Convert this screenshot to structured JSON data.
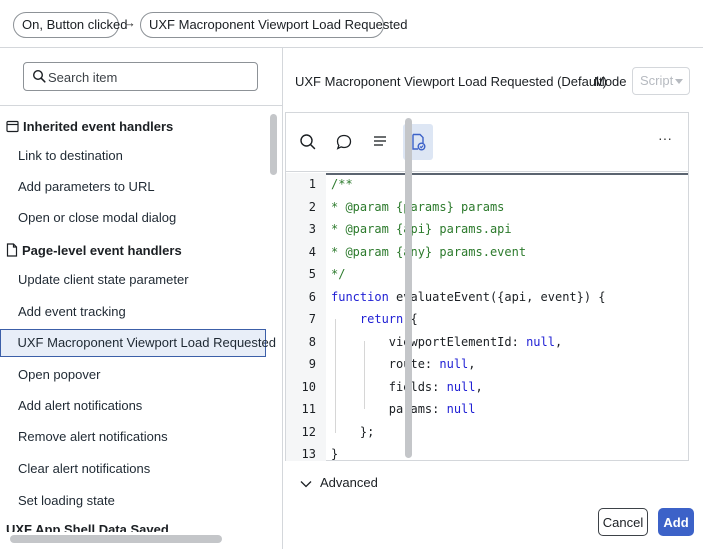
{
  "breadcrumb": {
    "items": [
      "On, Button clicked",
      "UXF Macroponent Viewport Load Requested"
    ],
    "separator": "→"
  },
  "search": {
    "placeholder": "Search item"
  },
  "sections": {
    "inherited": {
      "title": "Inherited event handlers",
      "items": [
        "Link to destination",
        "Add parameters to URL",
        "Open or close modal dialog"
      ]
    },
    "page_level": {
      "title": "Page-level event handlers",
      "items": [
        "Update client state parameter",
        "Add event tracking",
        "UXF Macroponent Viewport Load Requested",
        "Open popover",
        "Add alert notifications",
        "Remove alert notifications",
        "Clear alert notifications",
        "Set loading state"
      ],
      "selected": "UXF Macroponent Viewport Load Requested",
      "partial_next": "UXF App Shell Data Saved"
    }
  },
  "editor": {
    "title": "UXF Macroponent Viewport Load Requested (Default)",
    "mode_label": "Mode",
    "mode_value": "Script",
    "more_label": "···",
    "code": [
      {
        "n": "1",
        "t": "/**"
      },
      {
        "n": "2",
        "t": "* @param {params} params"
      },
      {
        "n": "3",
        "t": "* @param {api} params.api"
      },
      {
        "n": "4",
        "t": "* @param {any} params.event"
      },
      {
        "n": "5",
        "t": "*/"
      },
      {
        "n": "6",
        "t": "function evaluateEvent({api, event}) {"
      },
      {
        "n": "7",
        "t": "    return {"
      },
      {
        "n": "8",
        "t": "        viewportElementId: null,"
      },
      {
        "n": "9",
        "t": "        route: null,"
      },
      {
        "n": "10",
        "t": "        fields: null,"
      },
      {
        "n": "11",
        "t": "        params: null"
      },
      {
        "n": "12",
        "t": "    };"
      },
      {
        "n": "13",
        "t": "}"
      }
    ]
  },
  "advanced": {
    "label": "Advanced"
  },
  "buttons": {
    "cancel": "Cancel",
    "add": "Add"
  },
  "colors": {
    "accent": "#3c62c8",
    "selected_bg": "#e8eef8",
    "comment": "#2c7a2c",
    "keyword": "#1f1fd4"
  }
}
